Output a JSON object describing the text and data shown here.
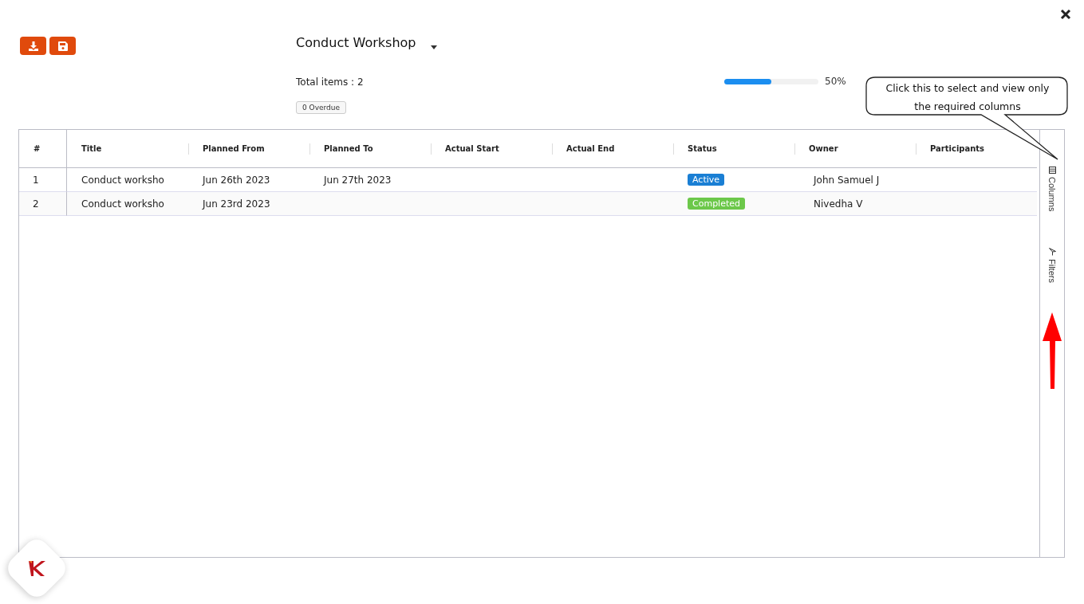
{
  "header": {
    "title": "Conduct Workshop",
    "total_items": "Total items : 2",
    "overdue_badge": "0 Overdue",
    "progress": {
      "level": 0.5,
      "reading": "50%"
    }
  },
  "table": {
    "columns": [
      "#",
      "Title",
      "Planned From",
      "Planned To",
      "Actual Start",
      "Actual End",
      "Status",
      "Owner",
      "Participants"
    ],
    "rows": [
      {
        "number": "1",
        "title": "Conduct worksho",
        "planned_from": "Jun 26th 2023",
        "planned_to": "Jun 27th 2023",
        "actual_start": "",
        "actual_end": "",
        "status": {
          "label": "Active",
          "color": "#1a7fd4"
        },
        "owner": "John Samuel J",
        "participants": ""
      },
      {
        "number": "2",
        "title": "Conduct worksho",
        "planned_from": "Jun 23rd 2023",
        "planned_to": "",
        "actual_start": "",
        "actual_end": "",
        "status": {
          "label": "Completed",
          "color": "#6cc84a"
        },
        "owner": "Nivedha V",
        "participants": ""
      }
    ]
  },
  "side_panel": [
    {
      "label": "Columns",
      "kind": "columns"
    },
    {
      "label": "Filters",
      "kind": "filters"
    }
  ],
  "callout": {
    "text": "Click this to select and view only the required columns"
  }
}
